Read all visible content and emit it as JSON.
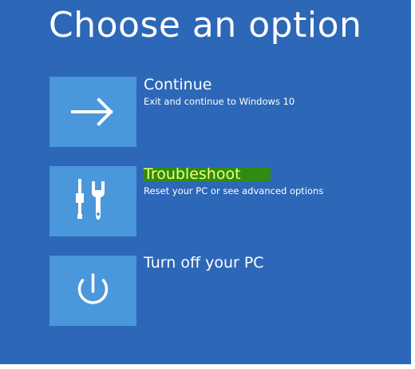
{
  "page": {
    "title": "Choose an option"
  },
  "options": [
    {
      "title": "Continue",
      "description": "Exit and continue to Windows 10",
      "icon": "arrow-right-icon"
    },
    {
      "title": "Troubleshoot",
      "description": "Reset your PC or see advanced options",
      "icon": "tools-icon",
      "highlight_color": "#2f8c12",
      "highlight_text_color": "#f2ff76"
    },
    {
      "title": "Turn off your PC",
      "icon": "power-icon"
    }
  ],
  "colors": {
    "background": "#2d67b7",
    "tile": "#4a97db",
    "text": "#ffffff"
  }
}
